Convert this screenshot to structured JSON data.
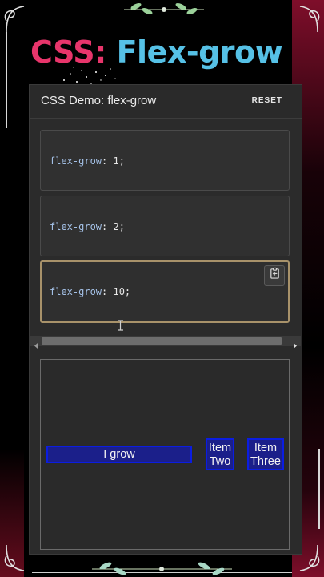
{
  "title": {
    "part1": "CSS:",
    "part2": "Flex-grow"
  },
  "demo": {
    "header_title": "CSS Demo: flex-grow",
    "reset_label": "RESET",
    "code_options": [
      {
        "property": "flex-grow",
        "value": "1;"
      },
      {
        "property": "flex-grow",
        "value": "2;"
      },
      {
        "property": "flex-grow",
        "value": "10;"
      }
    ],
    "selected_index": 2
  },
  "output": {
    "items": [
      "I grow",
      "Item Two",
      "Item Three"
    ]
  },
  "colors": {
    "title_css": "#e8356b",
    "title_flex": "#56c1e6",
    "selected_border": "#a8926a",
    "item_bg": "#1b1f8a",
    "item_border": "#0b1de0"
  },
  "icons": [
    "copy-icon",
    "text-cursor-icon",
    "scroll-left-arrow-icon",
    "scroll-right-arrow-icon"
  ]
}
